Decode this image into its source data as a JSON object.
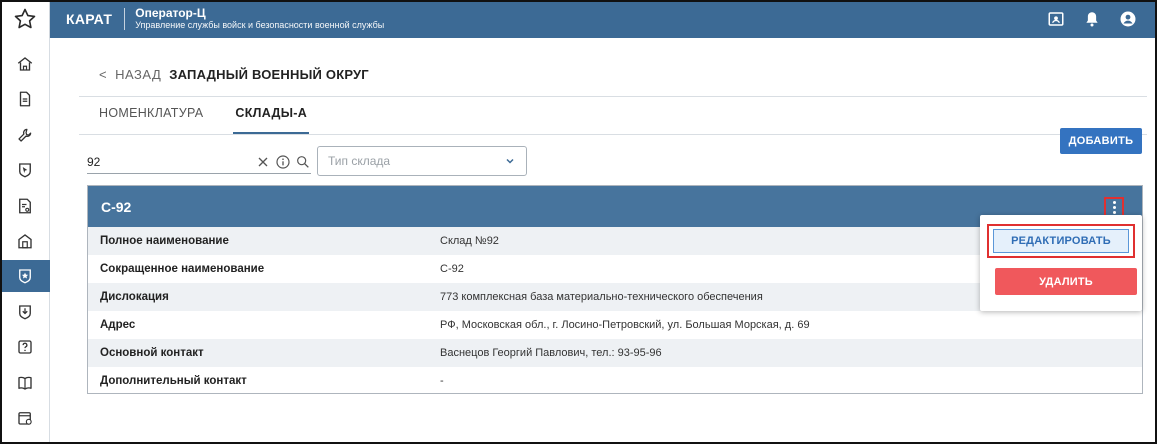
{
  "header": {
    "brand": "КАРАТ",
    "title": "Оператор-Ц",
    "subtitle": "Управление службы войск и безопасности военной службы"
  },
  "top_icons": [
    "id-card-icon",
    "bell-icon",
    "user-circle-icon"
  ],
  "sidebar": {
    "items": [
      {
        "icon": "home-icon",
        "active": false
      },
      {
        "icon": "document-icon",
        "active": false
      },
      {
        "icon": "wrench-icon",
        "active": false
      },
      {
        "icon": "cursor-shield-icon",
        "active": false
      },
      {
        "icon": "report-icon",
        "active": false
      },
      {
        "icon": "building-icon",
        "active": false
      },
      {
        "icon": "star-shield-icon",
        "active": true
      },
      {
        "icon": "download-shield-icon",
        "active": false
      },
      {
        "icon": "question-icon",
        "active": false
      },
      {
        "icon": "book-icon",
        "active": false
      },
      {
        "icon": "calendar-icon",
        "active": false
      }
    ]
  },
  "breadcrumb": {
    "back_arrow": "<",
    "back_label": "НАЗАД",
    "title": "ЗАПАДНЫЙ ВОЕННЫЙ ОКРУГ"
  },
  "tabs": [
    {
      "label": "НОМЕНКЛАТУРА",
      "active": false
    },
    {
      "label": "СКЛАДЫ-А",
      "active": true
    }
  ],
  "add_button": "ДОБАВИТЬ",
  "search": {
    "value": "92"
  },
  "type_select": {
    "placeholder": "Тип склада"
  },
  "card": {
    "title": "С-92",
    "rows": [
      {
        "key": "Полное наименование",
        "value": "Склад №92"
      },
      {
        "key": "Сокращенное наименование",
        "value": "С-92"
      },
      {
        "key": "Дислокация",
        "value": "773 комплексная база материально-технического обеспечения"
      },
      {
        "key": "Адрес",
        "value": "РФ, Московская обл., г. Лосино-Петровский, ул. Большая Морская, д. 69"
      },
      {
        "key": "Основной контакт",
        "value": "Васнецов Георгий Павлович, тел.: 93-95-96"
      },
      {
        "key": "Дополнительный контакт",
        "value": "-"
      }
    ]
  },
  "menu": {
    "edit": "РЕДАКТИРОВАТЬ",
    "delete": "УДАЛИТЬ"
  },
  "colors": {
    "header": "#3c6a95",
    "card_header": "#47749d",
    "add_button": "#3473c0",
    "delete_button": "#f0585c",
    "highlight": "#e03030"
  }
}
